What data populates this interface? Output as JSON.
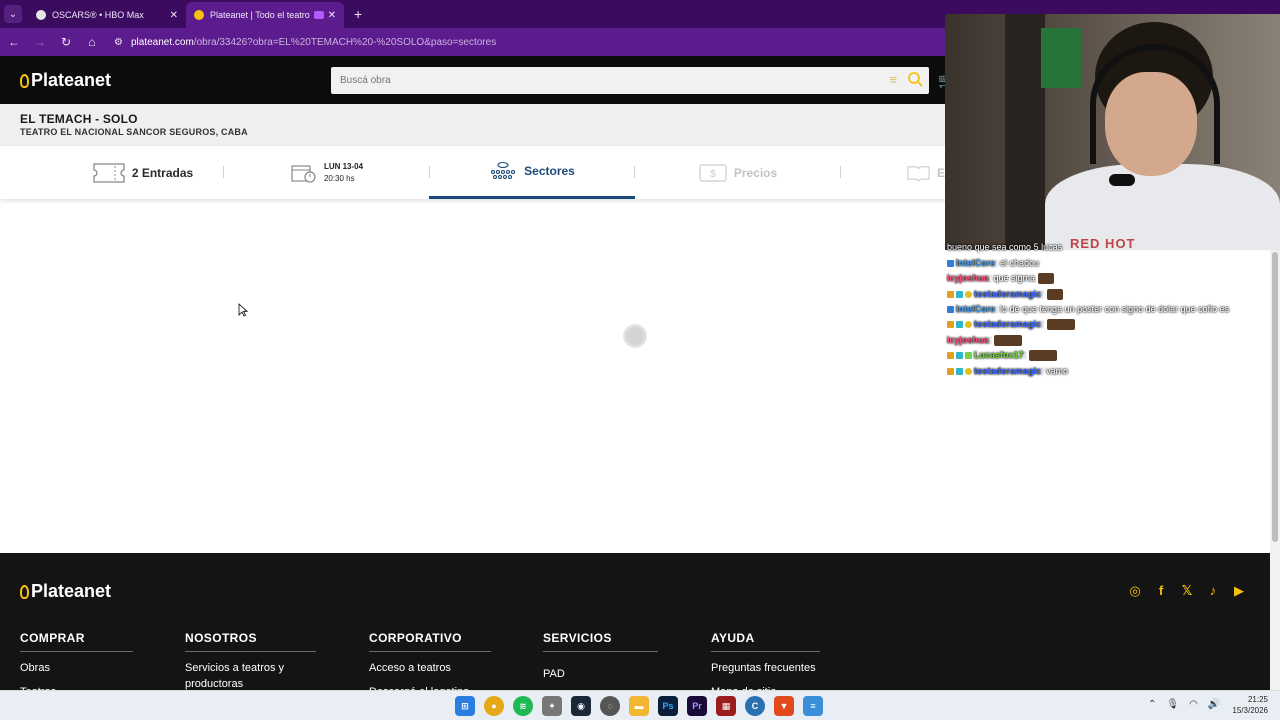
{
  "browser": {
    "tabs": [
      {
        "title": "OSCARS® • HBO Max",
        "active": false
      },
      {
        "title": "Plateanet | Todo el teatro p",
        "active": true
      }
    ],
    "new_tab": "+",
    "url_domain": "plateanet.com",
    "url_path": "/obra/33426?obra=EL%20TEMACH%20-%20SOLO&paso=sectores"
  },
  "site": {
    "logo": "Plateanet",
    "search_placeholder": "Buscá obra"
  },
  "show": {
    "title": "EL TEMACH - SOLO",
    "venue": "TEATRO EL NACIONAL SANCOR SEGUROS, CABA"
  },
  "steps": {
    "entradas": "2 Entradas",
    "fecha_dia": "LUN 13-04",
    "fecha_hora": "20:30 hs",
    "sectores": "Sectores",
    "precios": "Precios",
    "next_partial": "E"
  },
  "chat": {
    "lines": [
      {
        "user": "",
        "text": "bueno que sea como 5 lucas",
        "color": "#ffffff"
      },
      {
        "user": "IntelCore",
        "text": ": el chadou",
        "color": "#3aa0ff"
      },
      {
        "user": "icyjoshua",
        "text": ": que sigma",
        "color": "#ff4f7a"
      },
      {
        "user": "tostadoramagic",
        "text": ":",
        "color": "#3b6cff"
      },
      {
        "user": "IntelCore",
        "text": ": lo de que tenga un poster con signo de dolar que cofio es",
        "color": "#3aa0ff"
      },
      {
        "user": "tostadoramagic",
        "text": ":",
        "color": "#3b6cff"
      },
      {
        "user": "icyjoshua",
        "text": ":",
        "color": "#ff4f7a"
      },
      {
        "user": "Lucasfox17",
        "text": ":",
        "color": "#6fdc3a"
      },
      {
        "user": "tostadoramagic",
        "text": ": vamo",
        "color": "#3b6cff"
      }
    ]
  },
  "footer": {
    "logo": "Plateanet",
    "columns": [
      {
        "head": "COMPRAR",
        "links": [
          "Obras",
          "Teatros"
        ]
      },
      {
        "head": "NOSOTROS",
        "links": [
          "Servicios a teatros y productoras"
        ]
      },
      {
        "head": "CORPORATIVO",
        "links": [
          "Acceso a teatros",
          "Descargá el logotipo"
        ]
      },
      {
        "head": "SERVICIOS",
        "links": [
          "PAD"
        ]
      },
      {
        "head": "AYUDA",
        "links": [
          "Preguntas frecuentes",
          "Mapa de sitio"
        ]
      }
    ]
  },
  "webcam": {
    "shirt_text": "RED HOT"
  },
  "taskbar": {
    "time": "21:25",
    "date": "15/3/2026"
  },
  "colors": {
    "accent_yellow": "#f6c20f",
    "step_active": "#1b4a7a",
    "browser_purple": "#5d1c8e"
  }
}
